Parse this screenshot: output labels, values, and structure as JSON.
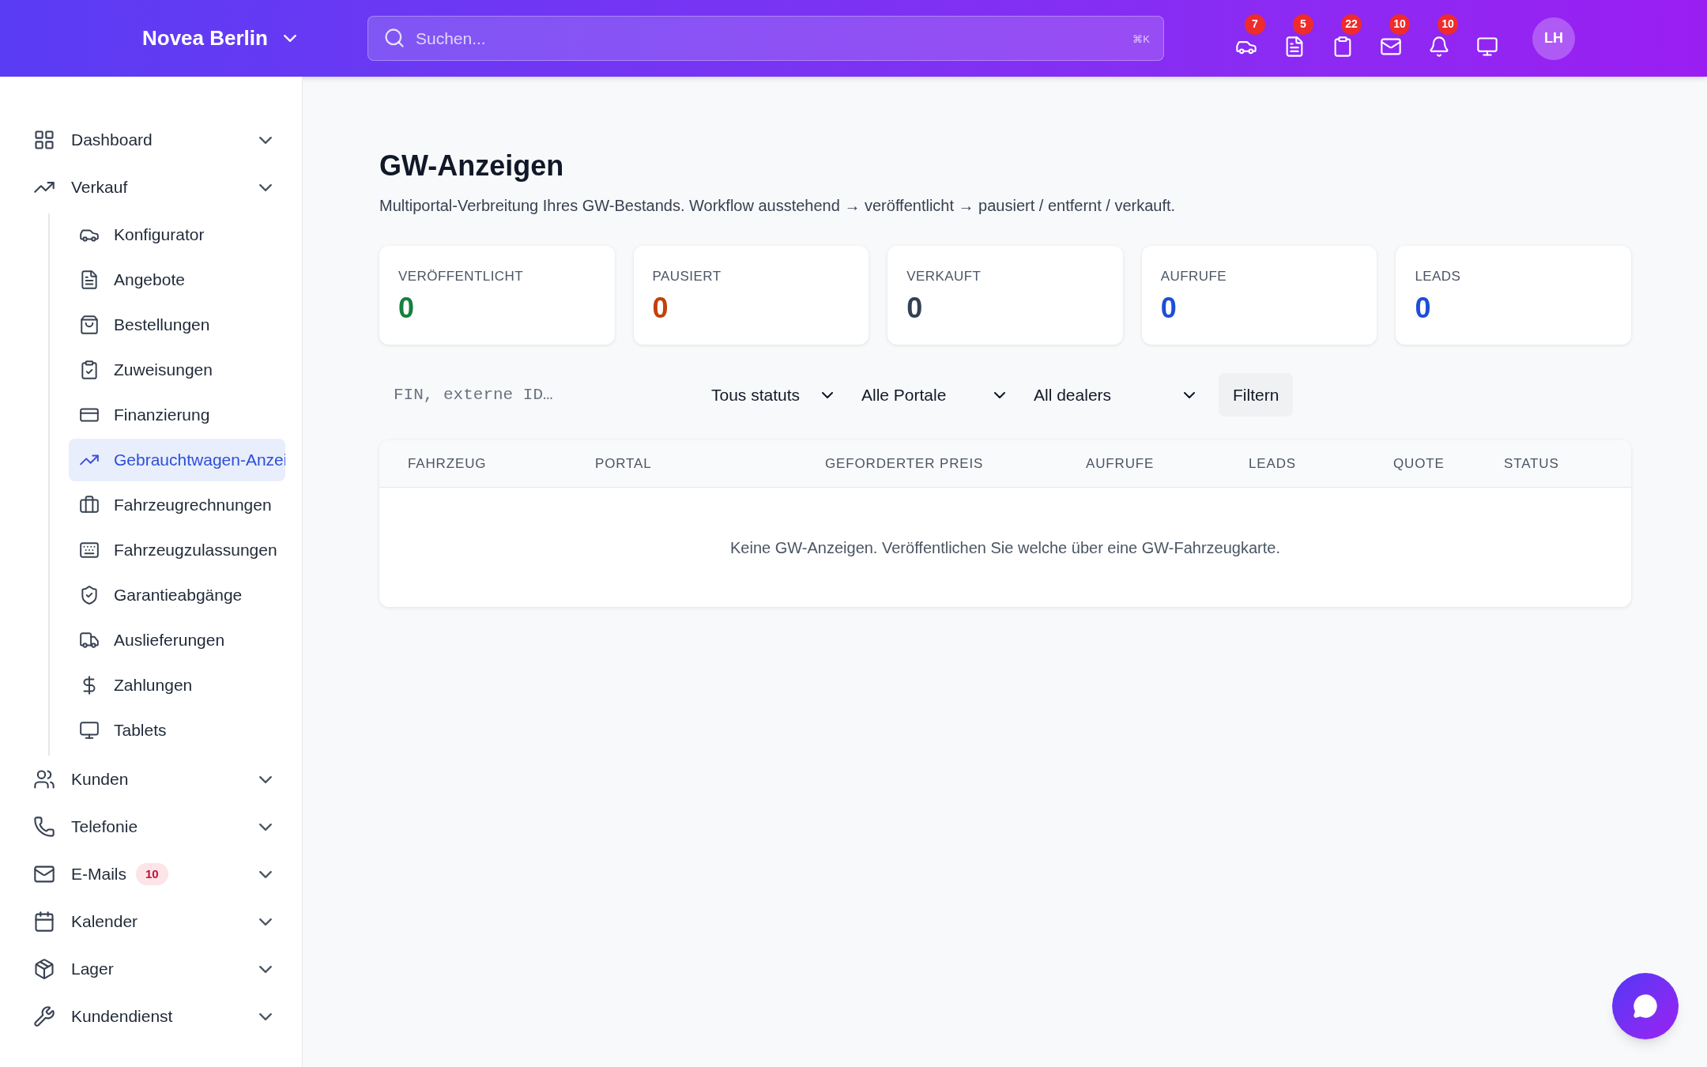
{
  "header": {
    "brand": "Novea Berlin",
    "search": {
      "placeholder": "Suchen...",
      "shortcut": "⌘K"
    },
    "icons": [
      {
        "badge": "7"
      },
      {
        "badge": "5"
      },
      {
        "badge": "22"
      },
      {
        "badge": "10"
      },
      {
        "badge": "10"
      }
    ],
    "avatar": "LH"
  },
  "sidebar": {
    "items": [
      {
        "label": "Dashboard"
      },
      {
        "label": "Verkauf",
        "children": [
          {
            "label": "Konfigurator",
            "selected": false
          },
          {
            "label": "Angebote",
            "selected": false
          },
          {
            "label": "Bestellungen",
            "selected": false
          },
          {
            "label": "Zuweisungen",
            "selected": false
          },
          {
            "label": "Finanzierung",
            "selected": false
          },
          {
            "label": "Gebrauchtwagen-Anzei",
            "selected": true
          },
          {
            "label": "Fahrzeugrechnungen",
            "selected": false
          },
          {
            "label": "Fahrzeugzulassungen",
            "selected": false
          },
          {
            "label": "Garantieabgänge",
            "selected": false
          },
          {
            "label": "Auslieferungen",
            "selected": false
          },
          {
            "label": "Zahlungen",
            "selected": false
          },
          {
            "label": "Tablets",
            "selected": false
          }
        ]
      },
      {
        "label": "Kunden"
      },
      {
        "label": "Telefonie"
      },
      {
        "label": "E-Mails",
        "badge": "10"
      },
      {
        "label": "Kalender"
      },
      {
        "label": "Lager"
      },
      {
        "label": "Kundendienst"
      }
    ]
  },
  "page": {
    "title": "GW-Anzeigen",
    "subtitle": "Multiportal-Verbreitung Ihres GW-Bestands. Workflow ausstehend → veröffentlicht → pausiert / entfernt / verkauft.",
    "stats": [
      {
        "label": "VERÖFFENTLICHT",
        "value": "0",
        "color": "#15803d"
      },
      {
        "label": "PAUSIERT",
        "value": "0",
        "color": "#c2410c"
      },
      {
        "label": "VERKAUFT",
        "value": "0",
        "color": "#334155"
      },
      {
        "label": "AUFRUFE",
        "value": "0",
        "color": "#1d4ed8"
      },
      {
        "label": "LEADS",
        "value": "0",
        "color": "#1d4ed8"
      }
    ],
    "filters": {
      "search": {
        "placeholder": "FIN, externe ID…"
      },
      "selects": [
        "Tous statuts",
        "Alle Portale",
        "All dealers"
      ],
      "button": "Filtern"
    },
    "table": {
      "columns": [
        "FAHRZEUG",
        "PORTAL",
        "GEFORDERTER PREIS",
        "AUFRUFE",
        "LEADS",
        "QUOTE",
        "STATUS"
      ],
      "empty_message": "Keine GW-Anzeigen. Veröffentlichen Sie welche über eine GW-Fahrzeugkarte."
    }
  }
}
